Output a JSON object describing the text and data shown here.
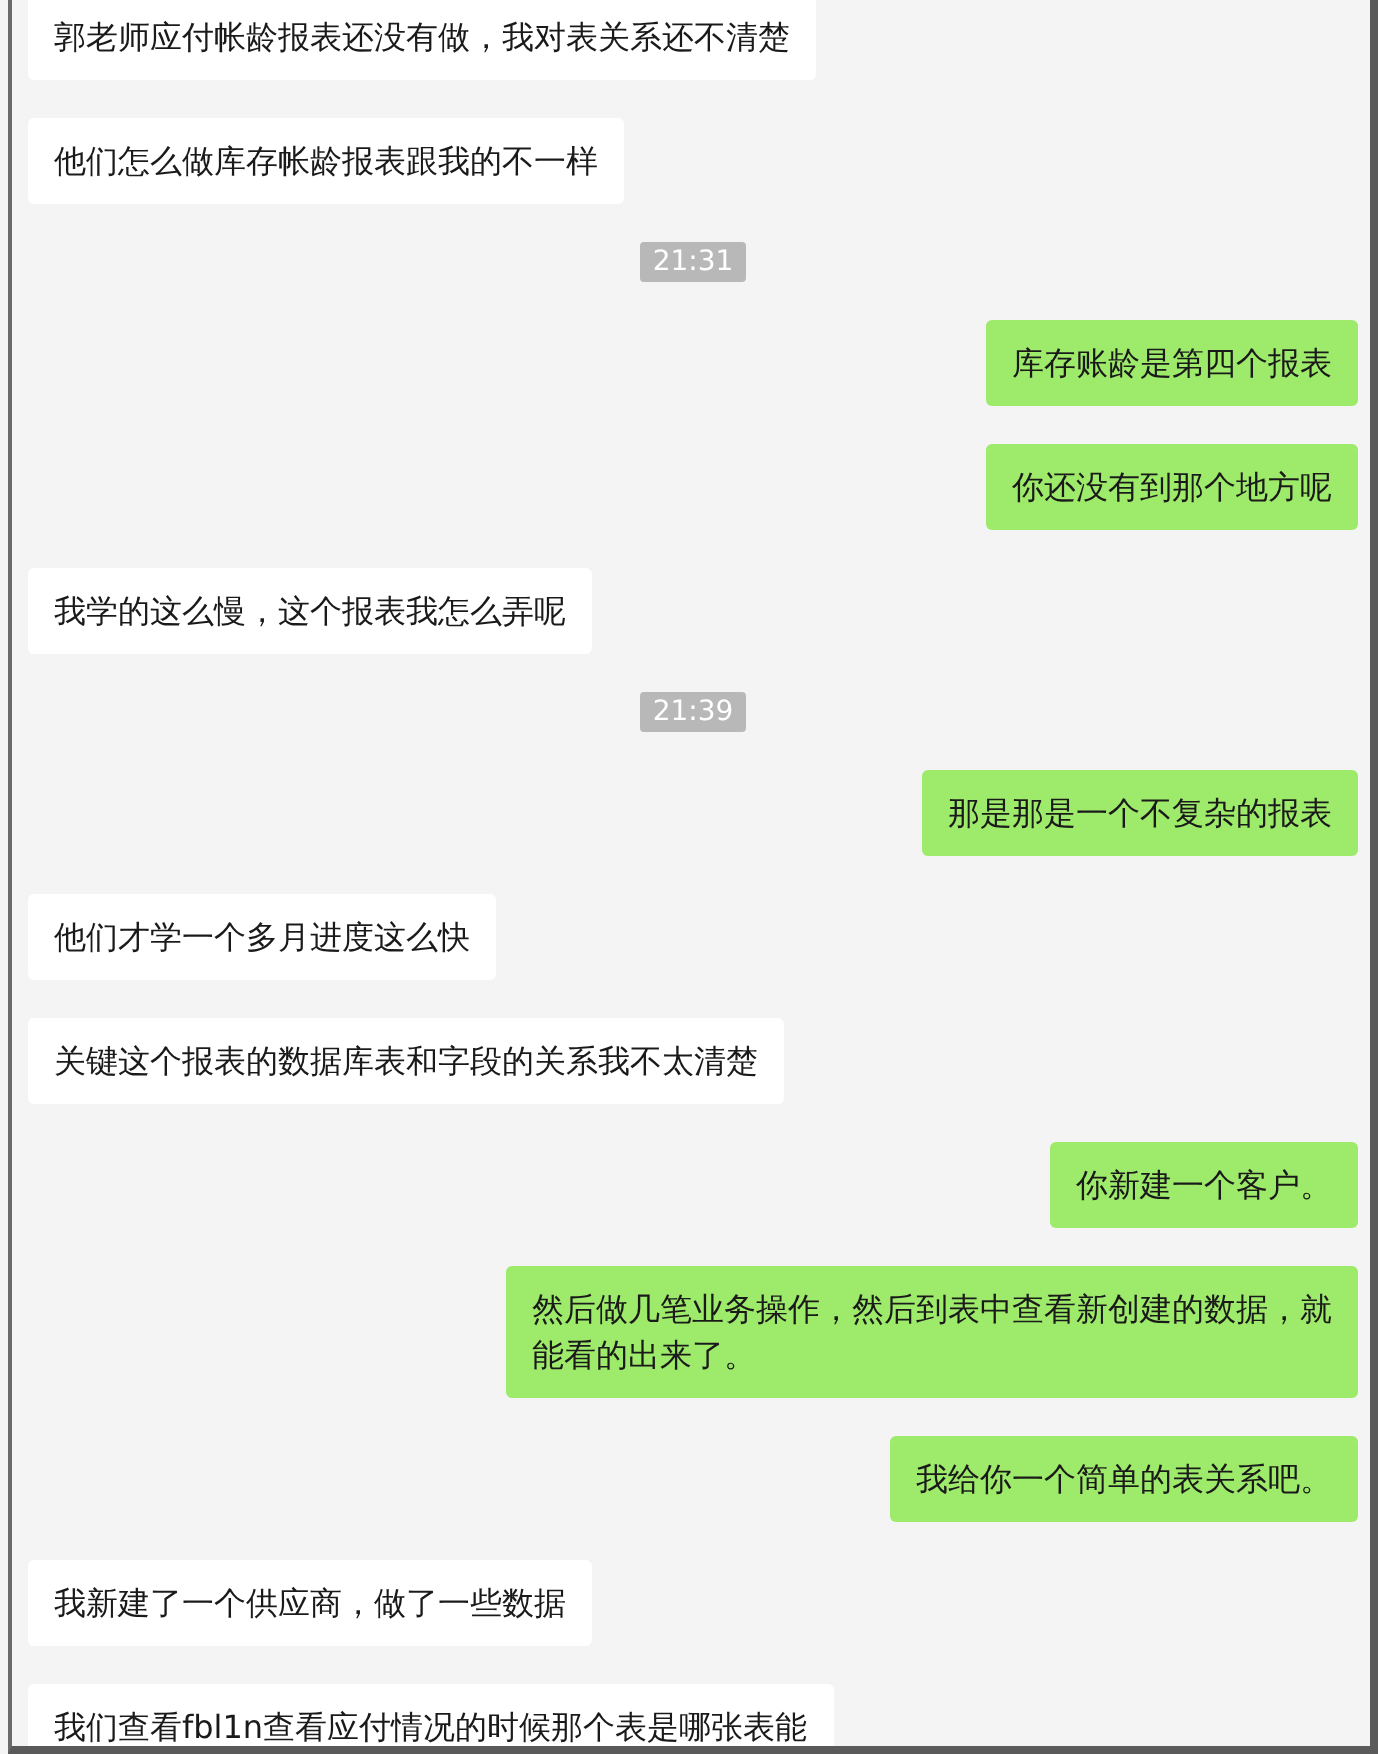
{
  "messages": [
    {
      "kind": "in",
      "text": "郭老师应付帐龄报表还没有做，我对表关系还不清楚"
    },
    {
      "kind": "in",
      "text": "他们怎么做库存帐龄报表跟我的不一样"
    },
    {
      "kind": "time",
      "text": "21:31"
    },
    {
      "kind": "out",
      "text": "库存账龄是第四个报表"
    },
    {
      "kind": "out",
      "text": "你还没有到那个地方呢"
    },
    {
      "kind": "in",
      "text": "我学的这么慢，这个报表我怎么弄呢"
    },
    {
      "kind": "time",
      "text": "21:39"
    },
    {
      "kind": "out",
      "text": "那是那是一个不复杂的报表"
    },
    {
      "kind": "in",
      "text": "他们才学一个多月进度这么快"
    },
    {
      "kind": "in",
      "text": "关键这个报表的数据库表和字段的关系我不太清楚"
    },
    {
      "kind": "out",
      "text": "你新建一个客户。"
    },
    {
      "kind": "out",
      "text": "然后做几笔业务操作，然后到表中查看新创建的数据，就能看的出来了。"
    },
    {
      "kind": "out",
      "text": "我给你一个简单的表关系吧。"
    },
    {
      "kind": "in",
      "text": "我新建了一个供应商，做了一些数据"
    },
    {
      "kind": "in",
      "text": "我们查看fbl1n查看应付情况的时候那个表是哪张表能"
    }
  ]
}
